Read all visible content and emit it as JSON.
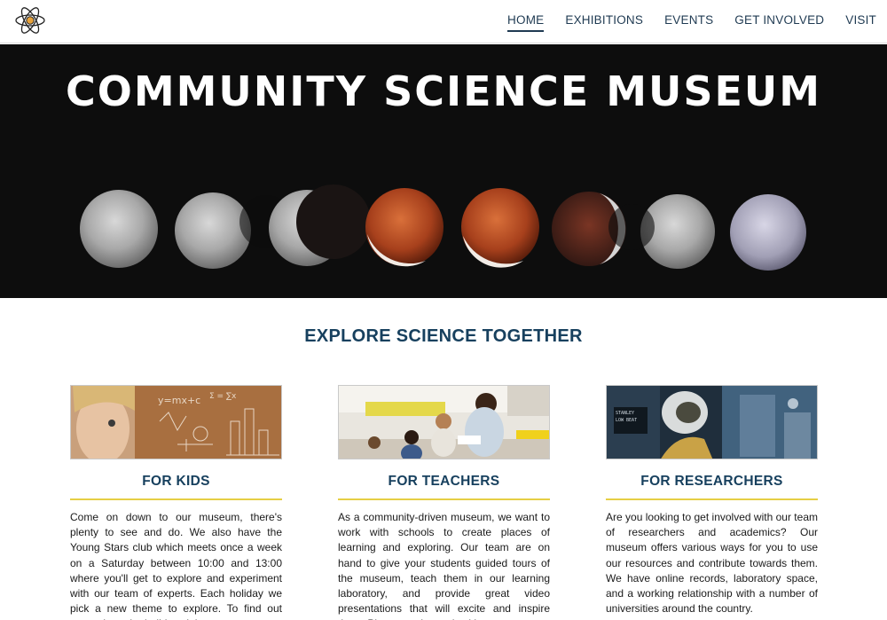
{
  "nav": {
    "logo": "atom-logo",
    "items": [
      {
        "label": "HOME",
        "active": true
      },
      {
        "label": "EXHIBITIONS",
        "active": false
      },
      {
        "label": "EVENTS",
        "active": false
      },
      {
        "label": "GET INVOLVED",
        "active": false
      },
      {
        "label": "VISIT",
        "active": false
      }
    ]
  },
  "hero": {
    "title": "COMMUNITY SCIENCE MUSEUM",
    "image": "lunar-eclipse-phases"
  },
  "section": {
    "title": "EXPLORE SCIENCE TOGETHER"
  },
  "cards": [
    {
      "title": "FOR KIDS",
      "image": "child-chalkboard-photo",
      "text": "Come on down to our museum, there's plenty to see and do. We also have the Young Stars club which meets once a week on a Saturday between 10:00 and 13:00 where you'll get to explore and experiment with our team of experts. Each holiday we pick a new theme to explore. To find out more about the holiday club"
    },
    {
      "title": "FOR TEACHERS",
      "image": "teacher-reading-photo",
      "text": "As a community-driven museum, we want to work with schools to create places of learning and exploring. Our team are on hand to give your students guided tours of the museum, teach them in our learning laboratory, and provide great video presentations that will excite and inspire them. Please get in touch with"
    },
    {
      "title": "FOR RESEARCHERS",
      "image": "astronaut-helmet-photo",
      "text": "Are you looking to get involved with our team of researchers and academics? Our museum offers various ways for you to use our resources and contribute towards them. We have online records, laboratory space, and a working relationship with a number of universities around the country."
    }
  ],
  "colors": {
    "navy": "#17405e",
    "accent_yellow": "#e6cf45",
    "hero_bg": "#0d0d0d"
  }
}
